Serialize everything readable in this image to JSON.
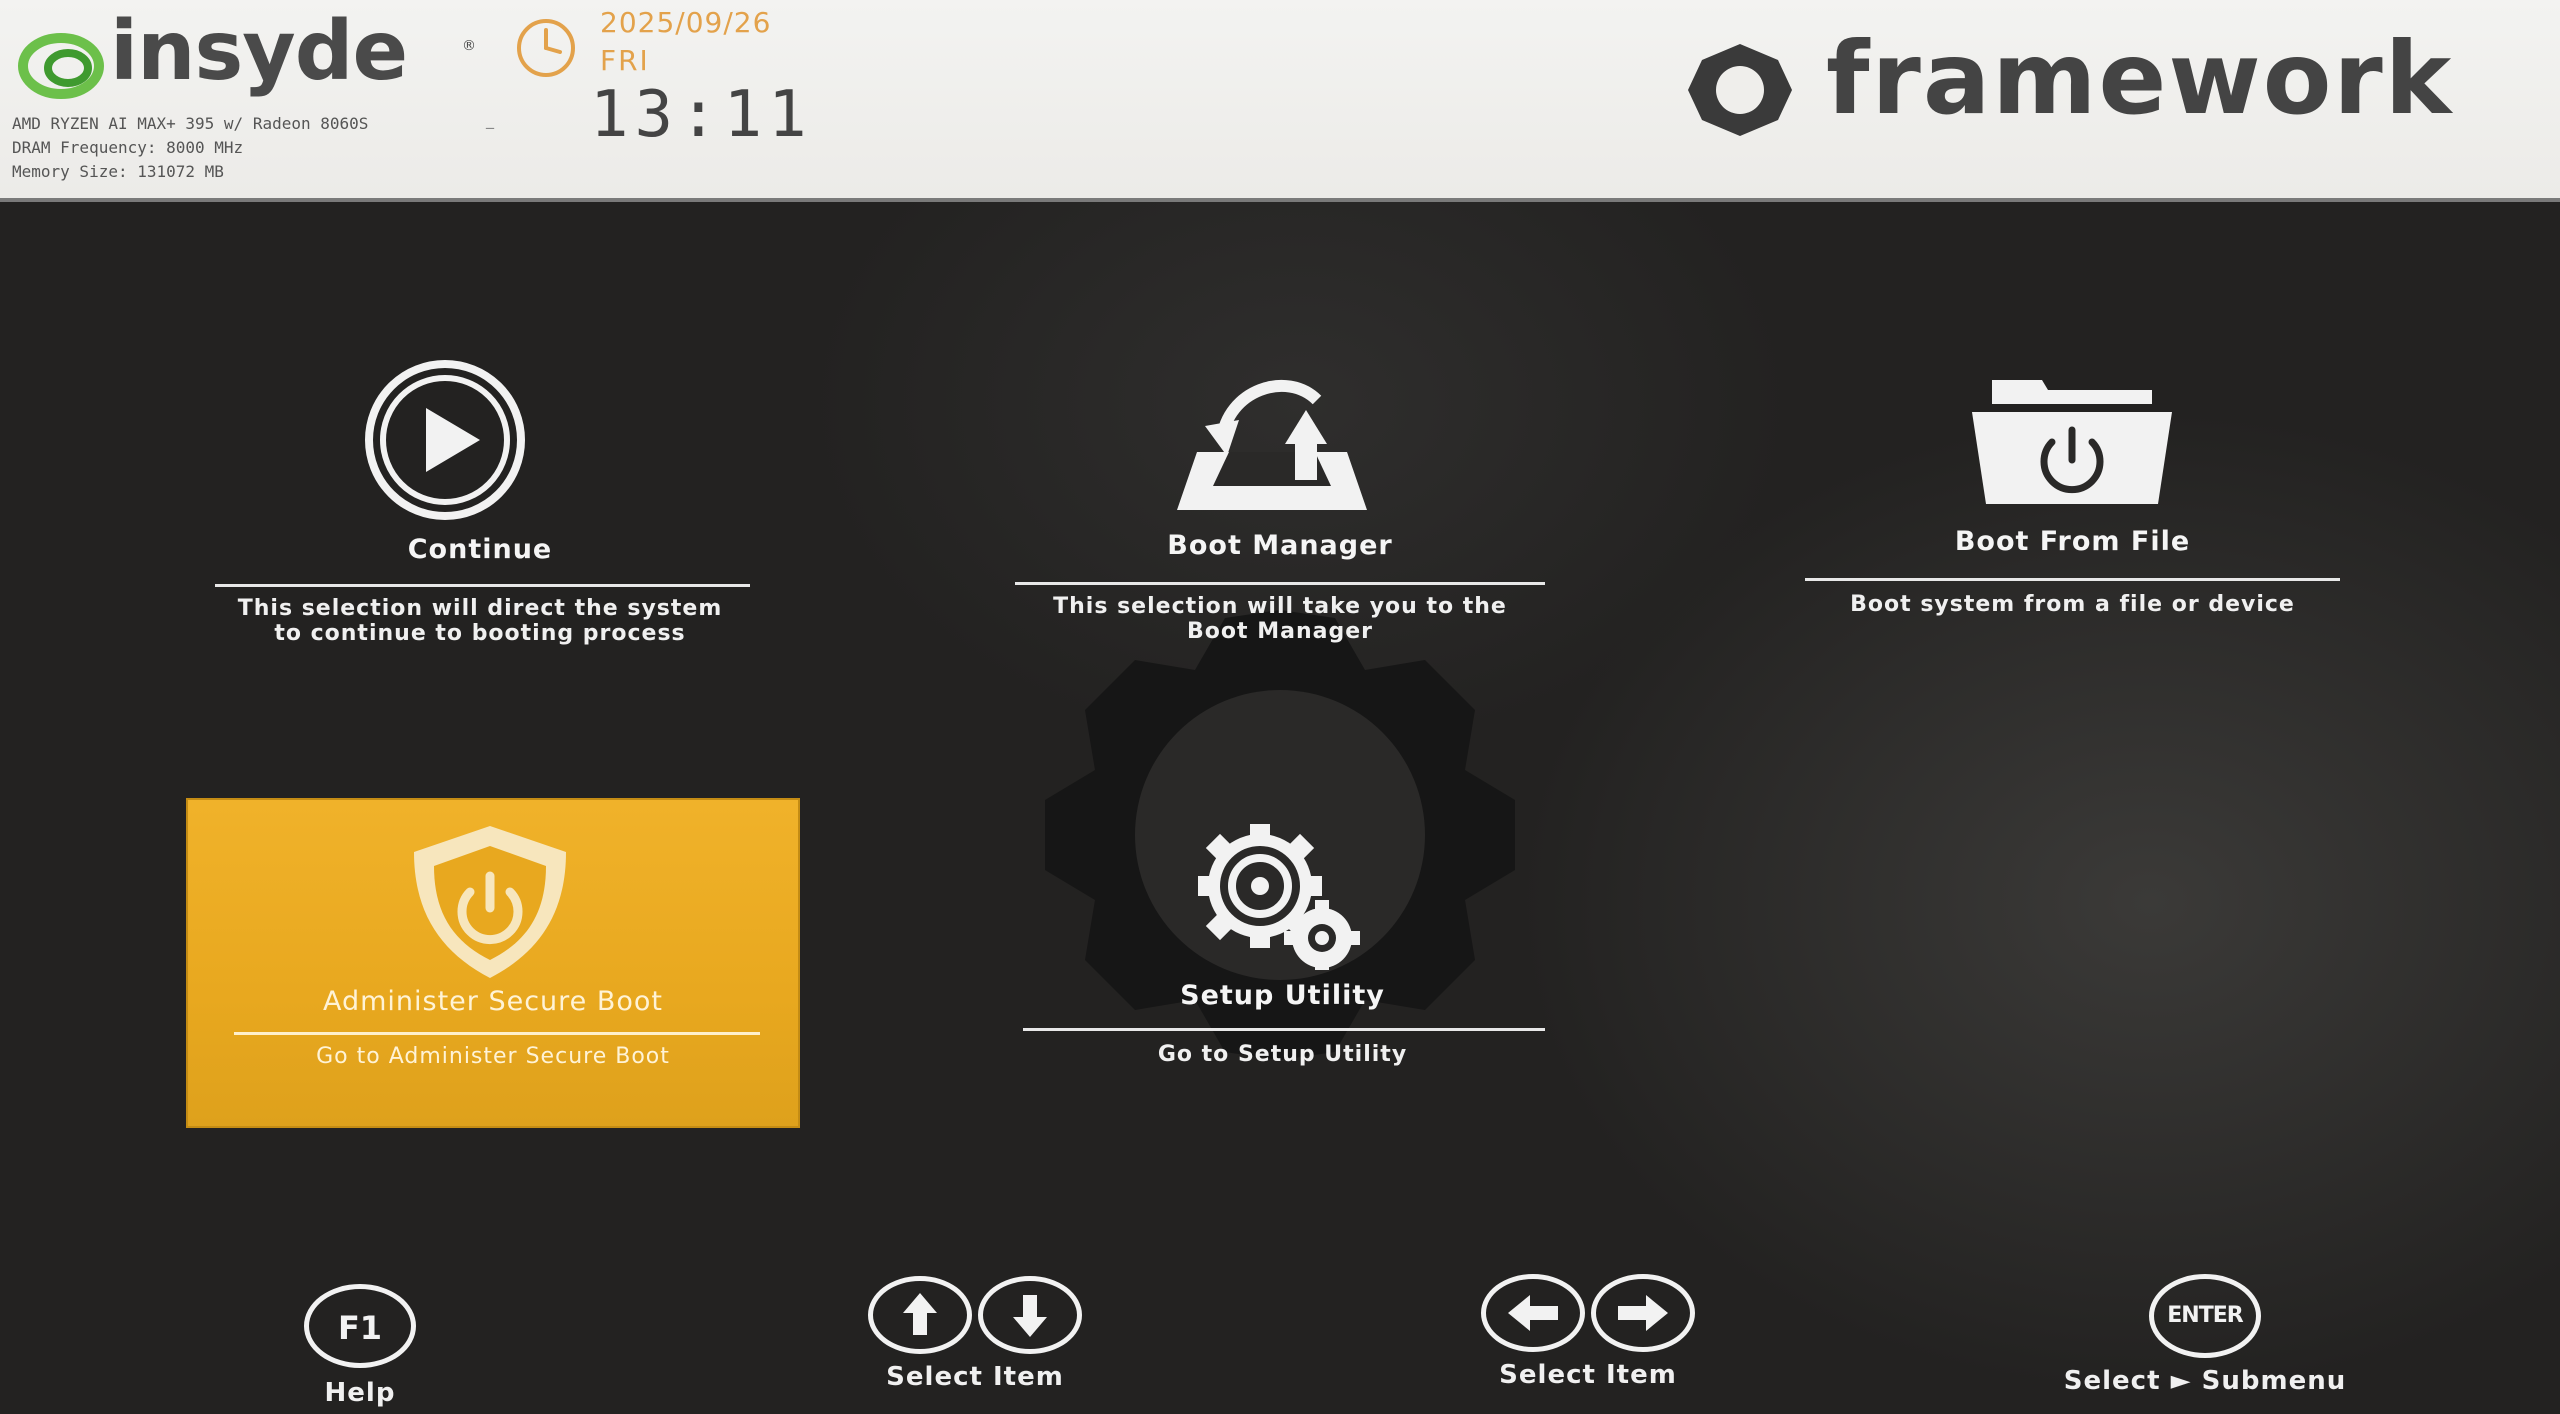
{
  "header": {
    "brand_left": "insyde",
    "brand_left_mark": "®",
    "system_info": [
      "AMD RYZEN AI MAX+ 395 w/ Radeon 8060S",
      "DRAM Frequency: 8000 MHz",
      "Memory Size: 131072 MB"
    ],
    "system_info_trail": "_",
    "date": "2025/09/26",
    "day": "FRI",
    "time": "13:11",
    "clock_icon": "clock-icon",
    "brand_right": "framework"
  },
  "menu": {
    "items": [
      {
        "title": "Continue",
        "description_lines": [
          "This selection will direct the system",
          "to continue to booting process"
        ],
        "icon": "play-icon",
        "selected": false
      },
      {
        "title": "Boot Manager",
        "description_lines": [
          "This selection will take you to the",
          "Boot Manager"
        ],
        "icon": "boot-manager-icon",
        "selected": false
      },
      {
        "title": "Boot From File",
        "description_lines": [
          "Boot system from a file or device"
        ],
        "icon": "folder-power-icon",
        "selected": false
      },
      {
        "title": "Administer Secure Boot",
        "description_lines": [
          "Go to Administer Secure Boot"
        ],
        "icon": "shield-power-icon",
        "selected": true
      },
      {
        "title": "Setup Utility",
        "description_lines": [
          "Go to Setup Utility"
        ],
        "icon": "gears-icon",
        "selected": false
      }
    ]
  },
  "footer": {
    "help": {
      "key": "F1",
      "label": "Help"
    },
    "select_item_vertical": {
      "keys": [
        "arrow-up-icon",
        "arrow-down-icon"
      ],
      "label": "Select Item"
    },
    "select_item_horizontal": {
      "keys": [
        "arrow-left-icon",
        "arrow-right-icon"
      ],
      "label": "Select Item"
    },
    "enter": {
      "key": "ENTER",
      "label": "Select ► Submenu"
    }
  },
  "colors": {
    "selected_tile": "#e8a81f",
    "clock_accent": "#e3a24b",
    "insyde_green": "#6cc04a",
    "background": "#232221"
  }
}
